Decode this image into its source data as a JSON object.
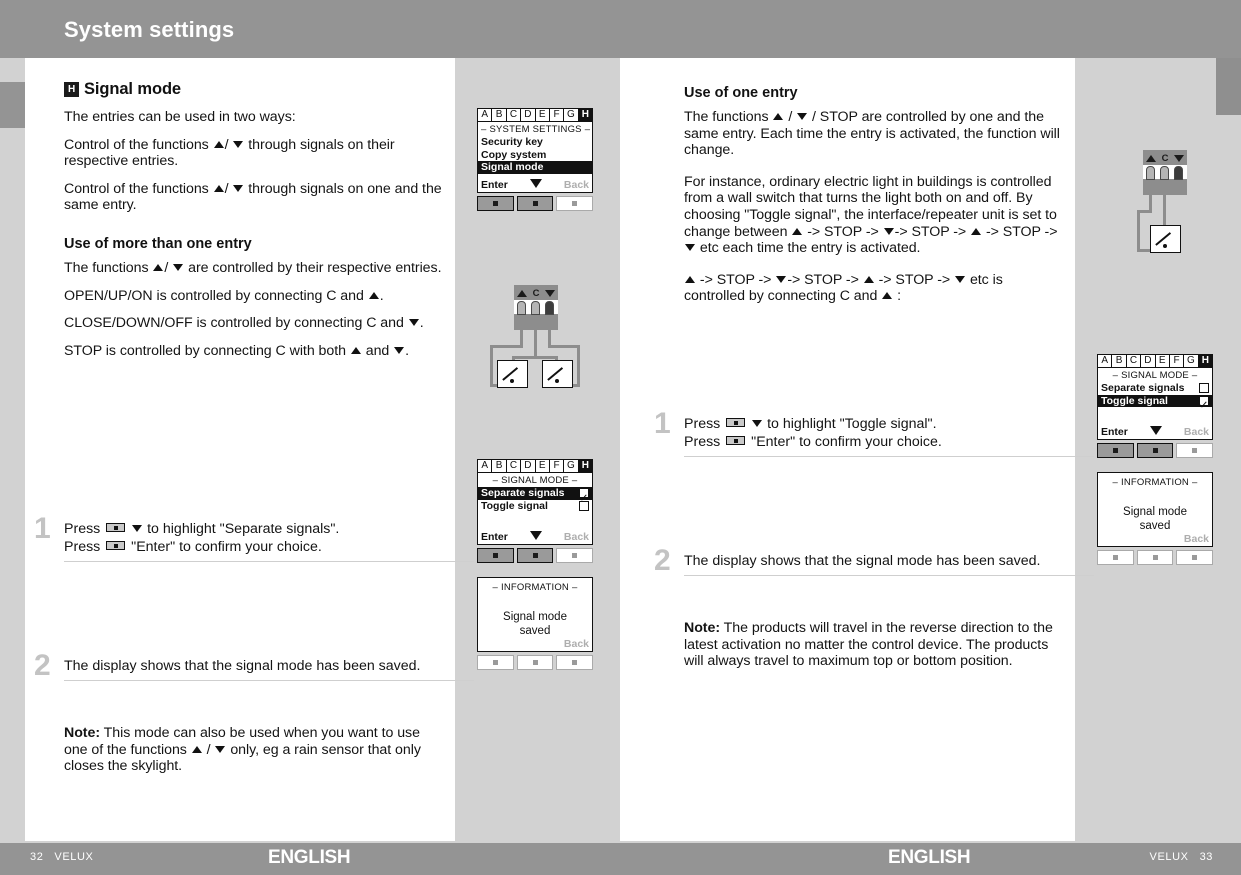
{
  "header": {
    "title": "System settings"
  },
  "footer": {
    "left_page": "32",
    "left_brand": "VELUX",
    "left_lang": "ENGLISH",
    "right_lang": "ENGLISH",
    "right_brand": "VELUX",
    "right_page": "33"
  },
  "left_column": {
    "section_badge": "H",
    "section_title": "Signal mode",
    "intro": "The entries can be used in two ways:",
    "bullet1": "Control of the functions ▲ / ▼ through signals on their respective entries.",
    "bullet2": "Control of the functions ▲ / ▼ through signals on one and the same entry.",
    "subhead": "Use of more than one entry",
    "para1": "The functions ▲/ ▼ are controlled by their respective entries.",
    "para2": "OPEN/UP/ON is controlled by connecting C and ▲.",
    "para3": "CLOSE/DOWN/OFF is controlled by connecting C and ▼.",
    "para4": "STOP is controlled by connecting C with both ▲ and ▼.",
    "step1_num": "1",
    "step1_line1": "Press ■ ▼ to highlight \"Separate signals\".",
    "step1_line2": "Press ■ \"Enter\" to confirm your choice.",
    "step2_num": "2",
    "step2_line1": "The display shows that the signal mode has been saved.",
    "note_label": "Note:",
    "note_text": "This mode can also be used when you want to use one of the functions ▲ / ▼ only, eg a rain sensor that only closes the skylight."
  },
  "right_column": {
    "subhead": "Use of one entry",
    "para1": "The functions ▲ / ▼ / STOP are controlled by one and the same entry. Each time the entry is activated, the function will change.",
    "para2": "For instance, ordinary electric light in buildings is controlled from a wall switch that turns the light both on and off. By choosing \"Toggle signal\", the interface/repeater unit is set to change between ▲ -> STOP -> ▼-> STOP -> ▲ -> STOP -> ▼ etc each time the entry is activated.",
    "para3": "▲ -> STOP -> ▼-> STOP -> ▲ -> STOP -> ▼ etc is controlled by connecting C and ▲ :",
    "step1_num": "1",
    "step1_line1": "Press ■ ▼ to highlight \"Toggle signal\".",
    "step1_line2": "Press ■ \"Enter\" to confirm your choice.",
    "step2_num": "2",
    "step2_line1": "The display shows that the signal mode has been saved.",
    "note_label": "Note:",
    "note_text": "The products will travel in the reverse direction to the latest activation no matter the control device. The products will always travel to maximum top or bottom position."
  },
  "screens": {
    "system_settings": {
      "tabs": [
        "A",
        "B",
        "C",
        "D",
        "E",
        "F",
        "G",
        "H"
      ],
      "active_tab": "H",
      "title": "SYSTEM SETTINGS",
      "rows": [
        {
          "label": "Security key",
          "selected": false
        },
        {
          "label": "Copy system",
          "selected": false
        },
        {
          "label": "Signal mode",
          "selected": true
        }
      ],
      "enter_label": "Enter",
      "back_label": "Back",
      "keys": [
        "dark",
        "dark",
        "light"
      ]
    },
    "signal_mode_separate": {
      "tabs": [
        "A",
        "B",
        "C",
        "D",
        "E",
        "F",
        "G",
        "H"
      ],
      "active_tab": "H",
      "title": "SIGNAL MODE",
      "rows": [
        {
          "label": "Separate signals",
          "selected": true,
          "checked": true
        },
        {
          "label": "Toggle signal",
          "selected": false,
          "checked": false
        }
      ],
      "enter_label": "Enter",
      "back_label": "Back",
      "keys": [
        "dark",
        "dark",
        "light"
      ]
    },
    "signal_mode_toggle": {
      "tabs": [
        "A",
        "B",
        "C",
        "D",
        "E",
        "F",
        "G",
        "H"
      ],
      "active_tab": "H",
      "title": "SIGNAL MODE",
      "rows": [
        {
          "label": "Separate signals",
          "selected": false,
          "checked": false
        },
        {
          "label": "Toggle signal",
          "selected": true,
          "checked": true
        }
      ],
      "enter_label": "Enter",
      "back_label": "Back",
      "keys": [
        "dark",
        "dark",
        "light"
      ]
    },
    "information_left": {
      "title": "INFORMATION",
      "message_line1": "Signal mode",
      "message_line2": "saved",
      "back_label": "Back",
      "keys": [
        "light",
        "light",
        "light"
      ]
    },
    "information_right": {
      "title": "INFORMATION",
      "message_line1": "Signal mode",
      "message_line2": "saved",
      "back_label": "Back",
      "keys": [
        "light",
        "light",
        "light"
      ]
    }
  },
  "diagrams": {
    "two_switch": {
      "terminal_labels": [
        "▲",
        "C",
        "▼"
      ],
      "switch_count": 2
    },
    "one_switch": {
      "terminal_labels": [
        "▲",
        "C",
        "▼"
      ],
      "switch_count": 1
    }
  },
  "colors": {
    "header_gray": "#949494",
    "page_gray": "#d2d2d2",
    "text_black": "#141414",
    "step_num_gray": "#c3c3c3",
    "lcd_black": "#111111",
    "wire_gray": "#8d8d8d"
  }
}
